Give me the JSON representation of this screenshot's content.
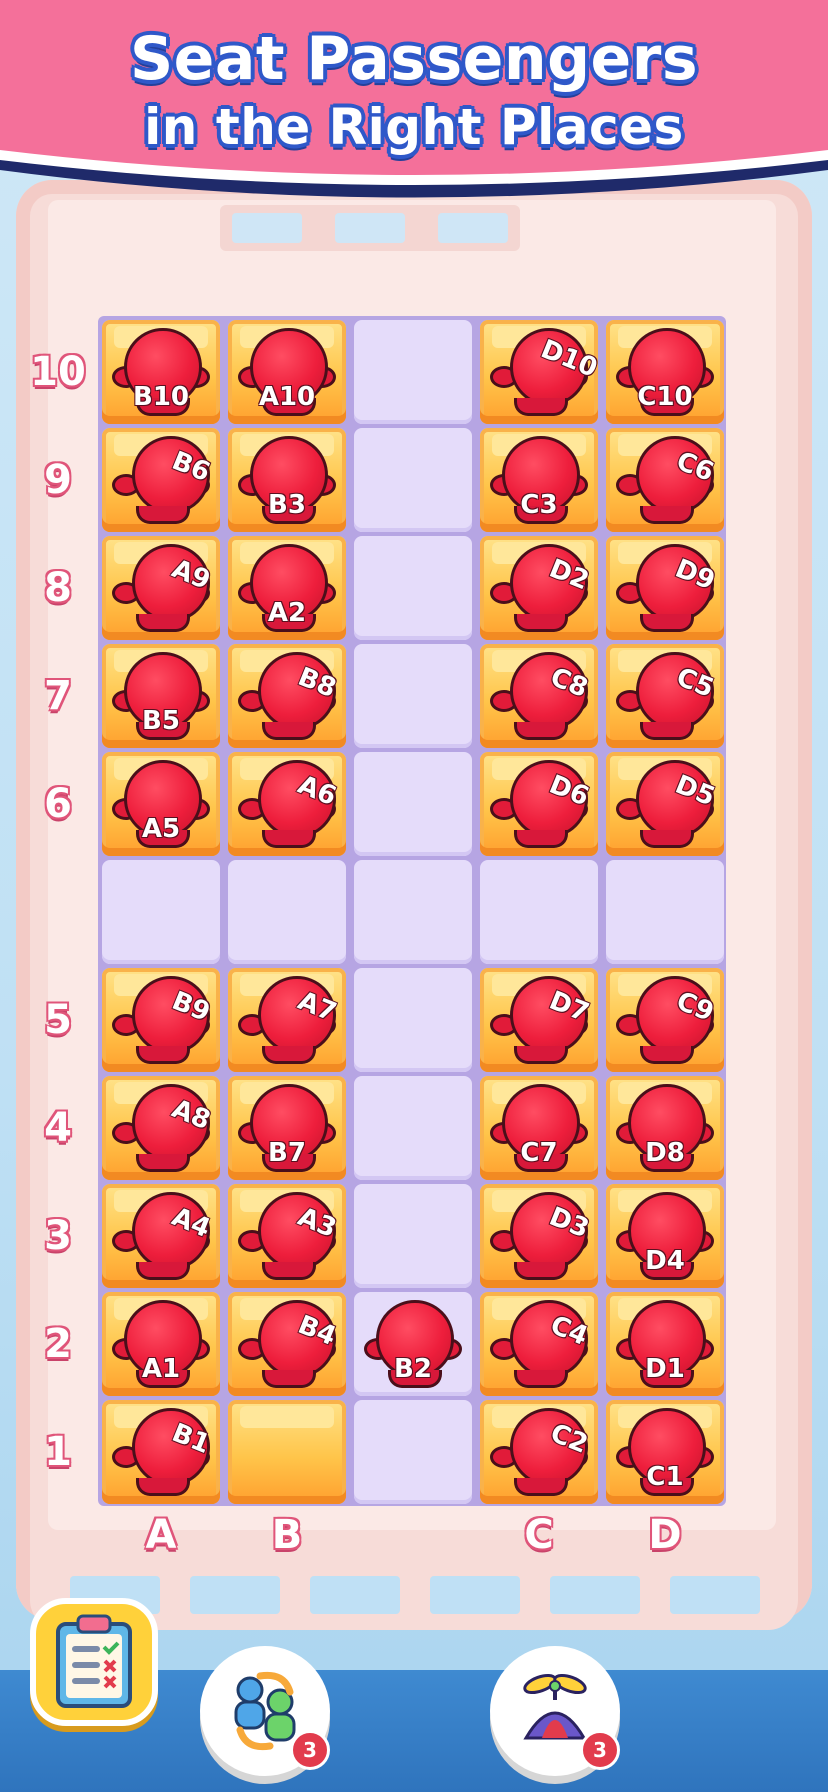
{
  "header": {
    "title_line1": "Seat Passengers",
    "title_line2": "in the Right Places"
  },
  "colors": {
    "banner_pink": "#f4709a",
    "title_outline": "#2f58c9",
    "seat_yellow": "#ffc54a",
    "passenger_red": "#ee1e3c",
    "aisle_lavender": "#e5dcfa",
    "label_pink": "#e0557a"
  },
  "columns": [
    "A",
    "B",
    "C",
    "D"
  ],
  "rows": [
    {
      "label": "10",
      "seats": [
        {
          "tag": "B10",
          "pose": "sitting"
        },
        {
          "tag": "A10",
          "pose": "sitting"
        },
        {
          "tag": "D10",
          "pose": "standing"
        },
        {
          "tag": "C10",
          "pose": "sitting"
        }
      ]
    },
    {
      "label": "9",
      "seats": [
        {
          "tag": "B6",
          "pose": "standing"
        },
        {
          "tag": "B3",
          "pose": "sitting"
        },
        {
          "tag": "C3",
          "pose": "sitting"
        },
        {
          "tag": "C6",
          "pose": "standing"
        }
      ]
    },
    {
      "label": "8",
      "seats": [
        {
          "tag": "A9",
          "pose": "standing"
        },
        {
          "tag": "A2",
          "pose": "sitting"
        },
        {
          "tag": "D2",
          "pose": "standing"
        },
        {
          "tag": "D9",
          "pose": "standing"
        }
      ]
    },
    {
      "label": "7",
      "seats": [
        {
          "tag": "B5",
          "pose": "sitting"
        },
        {
          "tag": "B8",
          "pose": "standing"
        },
        {
          "tag": "C8",
          "pose": "standing"
        },
        {
          "tag": "C5",
          "pose": "standing"
        }
      ]
    },
    {
      "label": "6",
      "seats": [
        {
          "tag": "A5",
          "pose": "sitting"
        },
        {
          "tag": "A6",
          "pose": "standing"
        },
        {
          "tag": "D6",
          "pose": "standing"
        },
        {
          "tag": "D5",
          "pose": "standing"
        }
      ]
    },
    {
      "label": "5",
      "seats": [
        {
          "tag": "B9",
          "pose": "standing"
        },
        {
          "tag": "A7",
          "pose": "standing"
        },
        {
          "tag": "D7",
          "pose": "standing"
        },
        {
          "tag": "C9",
          "pose": "standing"
        }
      ]
    },
    {
      "label": "4",
      "seats": [
        {
          "tag": "A8",
          "pose": "standing"
        },
        {
          "tag": "B7",
          "pose": "sitting"
        },
        {
          "tag": "C7",
          "pose": "sitting"
        },
        {
          "tag": "D8",
          "pose": "sitting"
        }
      ]
    },
    {
      "label": "3",
      "seats": [
        {
          "tag": "A4",
          "pose": "standing"
        },
        {
          "tag": "A3",
          "pose": "standing"
        },
        {
          "tag": "D3",
          "pose": "standing"
        },
        {
          "tag": "D4",
          "pose": "sitting"
        }
      ]
    },
    {
      "label": "2",
      "seats": [
        {
          "tag": "A1",
          "pose": "sitting"
        },
        {
          "tag": "B4",
          "pose": "standing"
        },
        {
          "tag": "C4",
          "pose": "standing"
        },
        {
          "tag": "D1",
          "pose": "sitting"
        }
      ]
    },
    {
      "label": "1",
      "seats": [
        {
          "tag": "B1",
          "pose": "standing"
        },
        {
          "tag": "",
          "pose": "empty"
        },
        {
          "tag": "C2",
          "pose": "standing"
        },
        {
          "tag": "C1",
          "pose": "sitting"
        }
      ]
    }
  ],
  "aisle_passenger": {
    "tag": "B2",
    "row_label": "2"
  },
  "toolbar": {
    "clipboard_icon": "clipboard-checklist-icon",
    "swap_icon": "swap-people-icon",
    "swap_count": "3",
    "propeller_icon": "propeller-hat-icon",
    "propeller_count": "3"
  }
}
